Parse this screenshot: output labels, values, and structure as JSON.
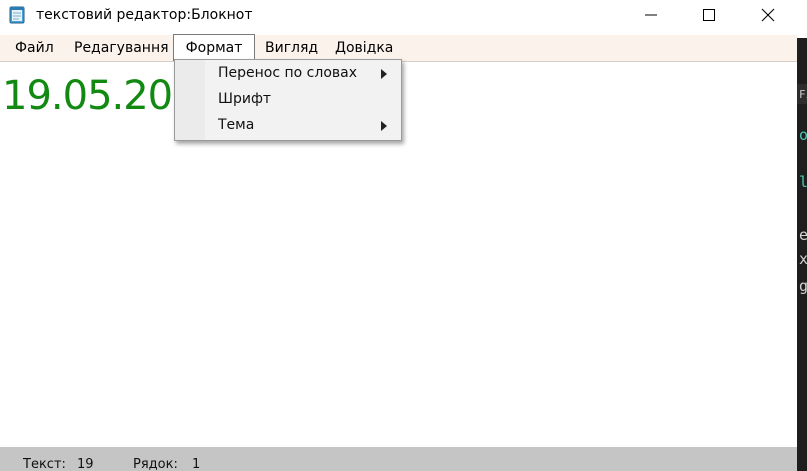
{
  "window": {
    "title": "текстовий редактор:Блокнот",
    "icon": "notepad-icon"
  },
  "controls": {
    "minimize": "minimize-icon",
    "maximize": "maximize-icon",
    "close": "close-icon"
  },
  "menu": {
    "items": [
      {
        "label": "Файл"
      },
      {
        "label": "Редагування"
      },
      {
        "label": "Формат"
      },
      {
        "label": "Вигляд"
      },
      {
        "label": "Довідка"
      }
    ],
    "open_menu": "Формат"
  },
  "format_dropdown": {
    "items": [
      {
        "label": "Перенос по словах",
        "has_submenu": true
      },
      {
        "label": "Шрифт",
        "has_submenu": false
      },
      {
        "label": "Тема",
        "has_submenu": true
      }
    ]
  },
  "editor": {
    "visible_text": "19.05.20",
    "text_color": "#128a12"
  },
  "status": {
    "text_label": "Текст:",
    "text_value": "19",
    "line_label": "Рядок:",
    "line_value": "1"
  },
  "background_window": {
    "visible_chars": [
      "Fi",
      "o",
      "l",
      "e",
      "x",
      "g"
    ]
  },
  "colors": {
    "menubar_bg": "#fcf2ec",
    "statusbar_bg": "#c5c5c5",
    "editor_text": "#128a12"
  }
}
